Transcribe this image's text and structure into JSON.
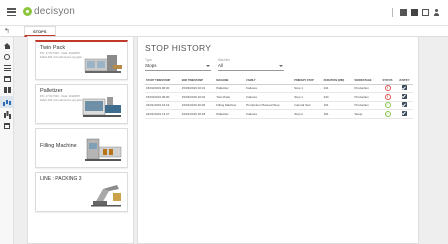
{
  "app": {
    "logo_text": "decisyon"
  },
  "tabs": {
    "back_glyph": "↰",
    "active_label": "STOPS"
  },
  "sidebar": {
    "icons": [
      "home-icon",
      "settings-icon",
      "list-icon",
      "calendar-icon",
      "grid-icon",
      "chart-icon",
      "bar-chart-icon",
      "trash-icon"
    ],
    "active": "chart-icon"
  },
  "machines": [
    {
      "name": "Twin Pack",
      "sub": "P/C: 17.03.7333 - Code: 2012MST\nFabric 300 m/ci (edit lemon up) glow",
      "selected": true,
      "accent": "#c0392b"
    },
    {
      "name": "Palletizer",
      "sub": "P/C: 17.03.7333 - Code: 2012MST\nFabric 300 m/ci (edit lemon up) glow",
      "selected": false
    },
    {
      "name": "Filling Machine",
      "sub": "",
      "selected": false
    },
    {
      "name": "LINE : PACKING 3",
      "sub": "",
      "selected": false
    }
  ],
  "main": {
    "title": "STOP HISTORY",
    "filters": {
      "type_label": "Type",
      "type_value": "Stops",
      "machine_label": "Machine",
      "machine_value": "All"
    },
    "table": {
      "columns": [
        "START TIMESTAMP",
        "END TIMESTAMP",
        "MACHINE",
        "FAMILY",
        "PRIMARY STOP",
        "DURATION (MIN)",
        "WORKSTAGE",
        "STATUS",
        "JUSTIFY"
      ],
      "rows": [
        {
          "start": "15/03/2019 06:00",
          "end": "15/03/2019 10:01",
          "machine": "Palletizer",
          "family": "Failures",
          "primary_stop": "Stop 1",
          "duration": "241",
          "workstage": "Production",
          "status": "error"
        },
        {
          "start": "15/03/2019 06:00",
          "end": "15/03/2019 10:04",
          "machine": "Twin Pack",
          "family": "Failures",
          "primary_stop": "Stop 1",
          "duration": "244",
          "workstage": "Production",
          "status": "error"
        },
        {
          "start": "24/01/2019 16:19",
          "end": "24/01/2019 20:00",
          "machine": "Filling Machine",
          "family": "Production Planned Stop",
          "primary_stop": "Internal Test",
          "duration": "161",
          "workstage": "Production",
          "status": "ok"
        },
        {
          "start": "24/01/2019 13:27",
          "end": "24/01/2019 18:18",
          "machine": "Palletizer",
          "family": "Failures",
          "primary_stop": "Stop 2",
          "duration": "161",
          "workstage": "Setup",
          "status": "ok"
        }
      ]
    }
  },
  "colors": {
    "accent_red": "#c0392b",
    "status_error": "#d9534f",
    "status_ok": "#8bc34a",
    "logo_green": "#8cc63f"
  }
}
